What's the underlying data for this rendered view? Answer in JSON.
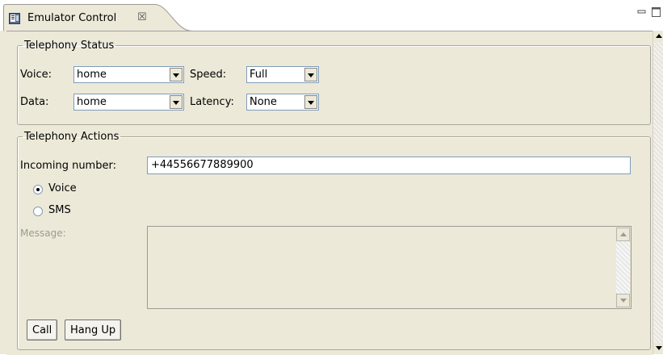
{
  "view": {
    "title": "Emulator Control",
    "close_glyph": "☒",
    "icon": "emulator-control-icon"
  },
  "telephony_status": {
    "legend": "Telephony Status",
    "voice_label": "Voice:",
    "voice_value": "home",
    "speed_label": "Speed:",
    "speed_value": "Full",
    "data_label": "Data:",
    "data_value": "home",
    "latency_label": "Latency:",
    "latency_value": "None"
  },
  "telephony_actions": {
    "legend": "Telephony Actions",
    "incoming_label": "Incoming number:",
    "incoming_value": "+44556677889900",
    "voice_radio": "Voice",
    "sms_radio": "SMS",
    "selected": "Voice",
    "message_label": "Message:",
    "message_value": "",
    "call_button": "Call",
    "hangup_button": "Hang Up"
  },
  "colors": {
    "panel_bg": "#ece9d8",
    "field_border": "#7f9db9",
    "disabled_text": "#9c9a94"
  }
}
